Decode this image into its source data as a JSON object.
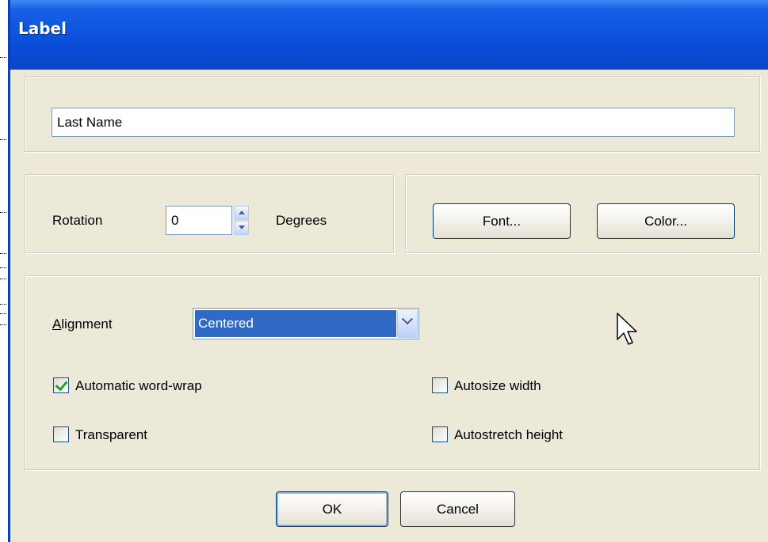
{
  "window": {
    "title": "Label"
  },
  "label_text": {
    "value": "Last Name"
  },
  "rotation": {
    "label": "Rotation",
    "value": "0",
    "unit": "Degrees"
  },
  "buttons": {
    "font": "Font...",
    "color": "Color...",
    "ok": "OK",
    "cancel": "Cancel"
  },
  "alignment": {
    "label": "Alignment",
    "access_key": "A",
    "label_rest": "lignment",
    "selected": "Centered"
  },
  "options": {
    "automatic_word_wrap": {
      "label": "Automatic word-wrap",
      "checked": true
    },
    "transparent": {
      "label": "Transparent",
      "checked": false
    },
    "autosize_width": {
      "label": "Autosize width",
      "checked": false
    },
    "autostretch_height": {
      "label": "Autostretch height",
      "checked": false
    }
  },
  "colors": {
    "titlebar": "#0b4fd8",
    "dialog_bg": "#ece9d8",
    "selection": "#316ac5",
    "check": "#21a121"
  }
}
